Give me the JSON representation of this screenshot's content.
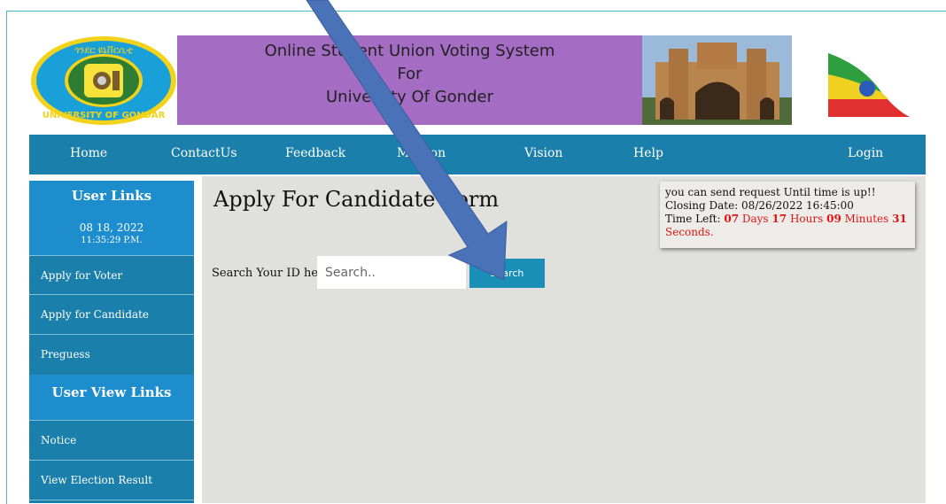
{
  "header": {
    "logo_text": "UNIVERSITY OF GONDAR",
    "banner": {
      "line1": "Online Student Union Voting System",
      "line2": "For",
      "line3": "University Of Gonder"
    }
  },
  "nav": {
    "items": [
      {
        "label": "Home"
      },
      {
        "label": "ContactUs"
      },
      {
        "label": "Feedback"
      },
      {
        "label": "Mission"
      },
      {
        "label": "Vision"
      },
      {
        "label": "Help"
      },
      {
        "label": "Login"
      }
    ]
  },
  "sidebar": {
    "user_links_title": "User Links",
    "date": "08 18, 2022",
    "time": "11:35:29 P.M.",
    "links": [
      {
        "label": "Apply for Voter"
      },
      {
        "label": "Apply for Candidate"
      },
      {
        "label": "Preguess"
      }
    ],
    "user_view_title": "User View Links",
    "view_links": [
      {
        "label": "Notice"
      },
      {
        "label": "View Election Result"
      }
    ]
  },
  "main": {
    "title": "Apply For Candidate Form",
    "search_label": "Search Your ID here",
    "search_placeholder": "Search..",
    "search_button": "Search"
  },
  "notice": {
    "line1": "you can send request Until time is up!!",
    "closing_label": "Closing Date:",
    "closing_date": "08/26/2022 16:45:00",
    "time_left_label": "Time Left:",
    "days_num": "07",
    "days_label": "Days",
    "hours_num": "17",
    "hours_label": "Hours",
    "minutes_num": "09",
    "minutes_label": "Minutes",
    "seconds_num": "31",
    "seconds_label": "Seconds."
  },
  "colors": {
    "nav_bg": "#1a7fab",
    "banner_bg": "#a46cc2",
    "sidebar_header": "#1d8dce",
    "main_bg": "#e0e0dc",
    "arrow": "#4a72b8",
    "countdown": "#e01414"
  }
}
